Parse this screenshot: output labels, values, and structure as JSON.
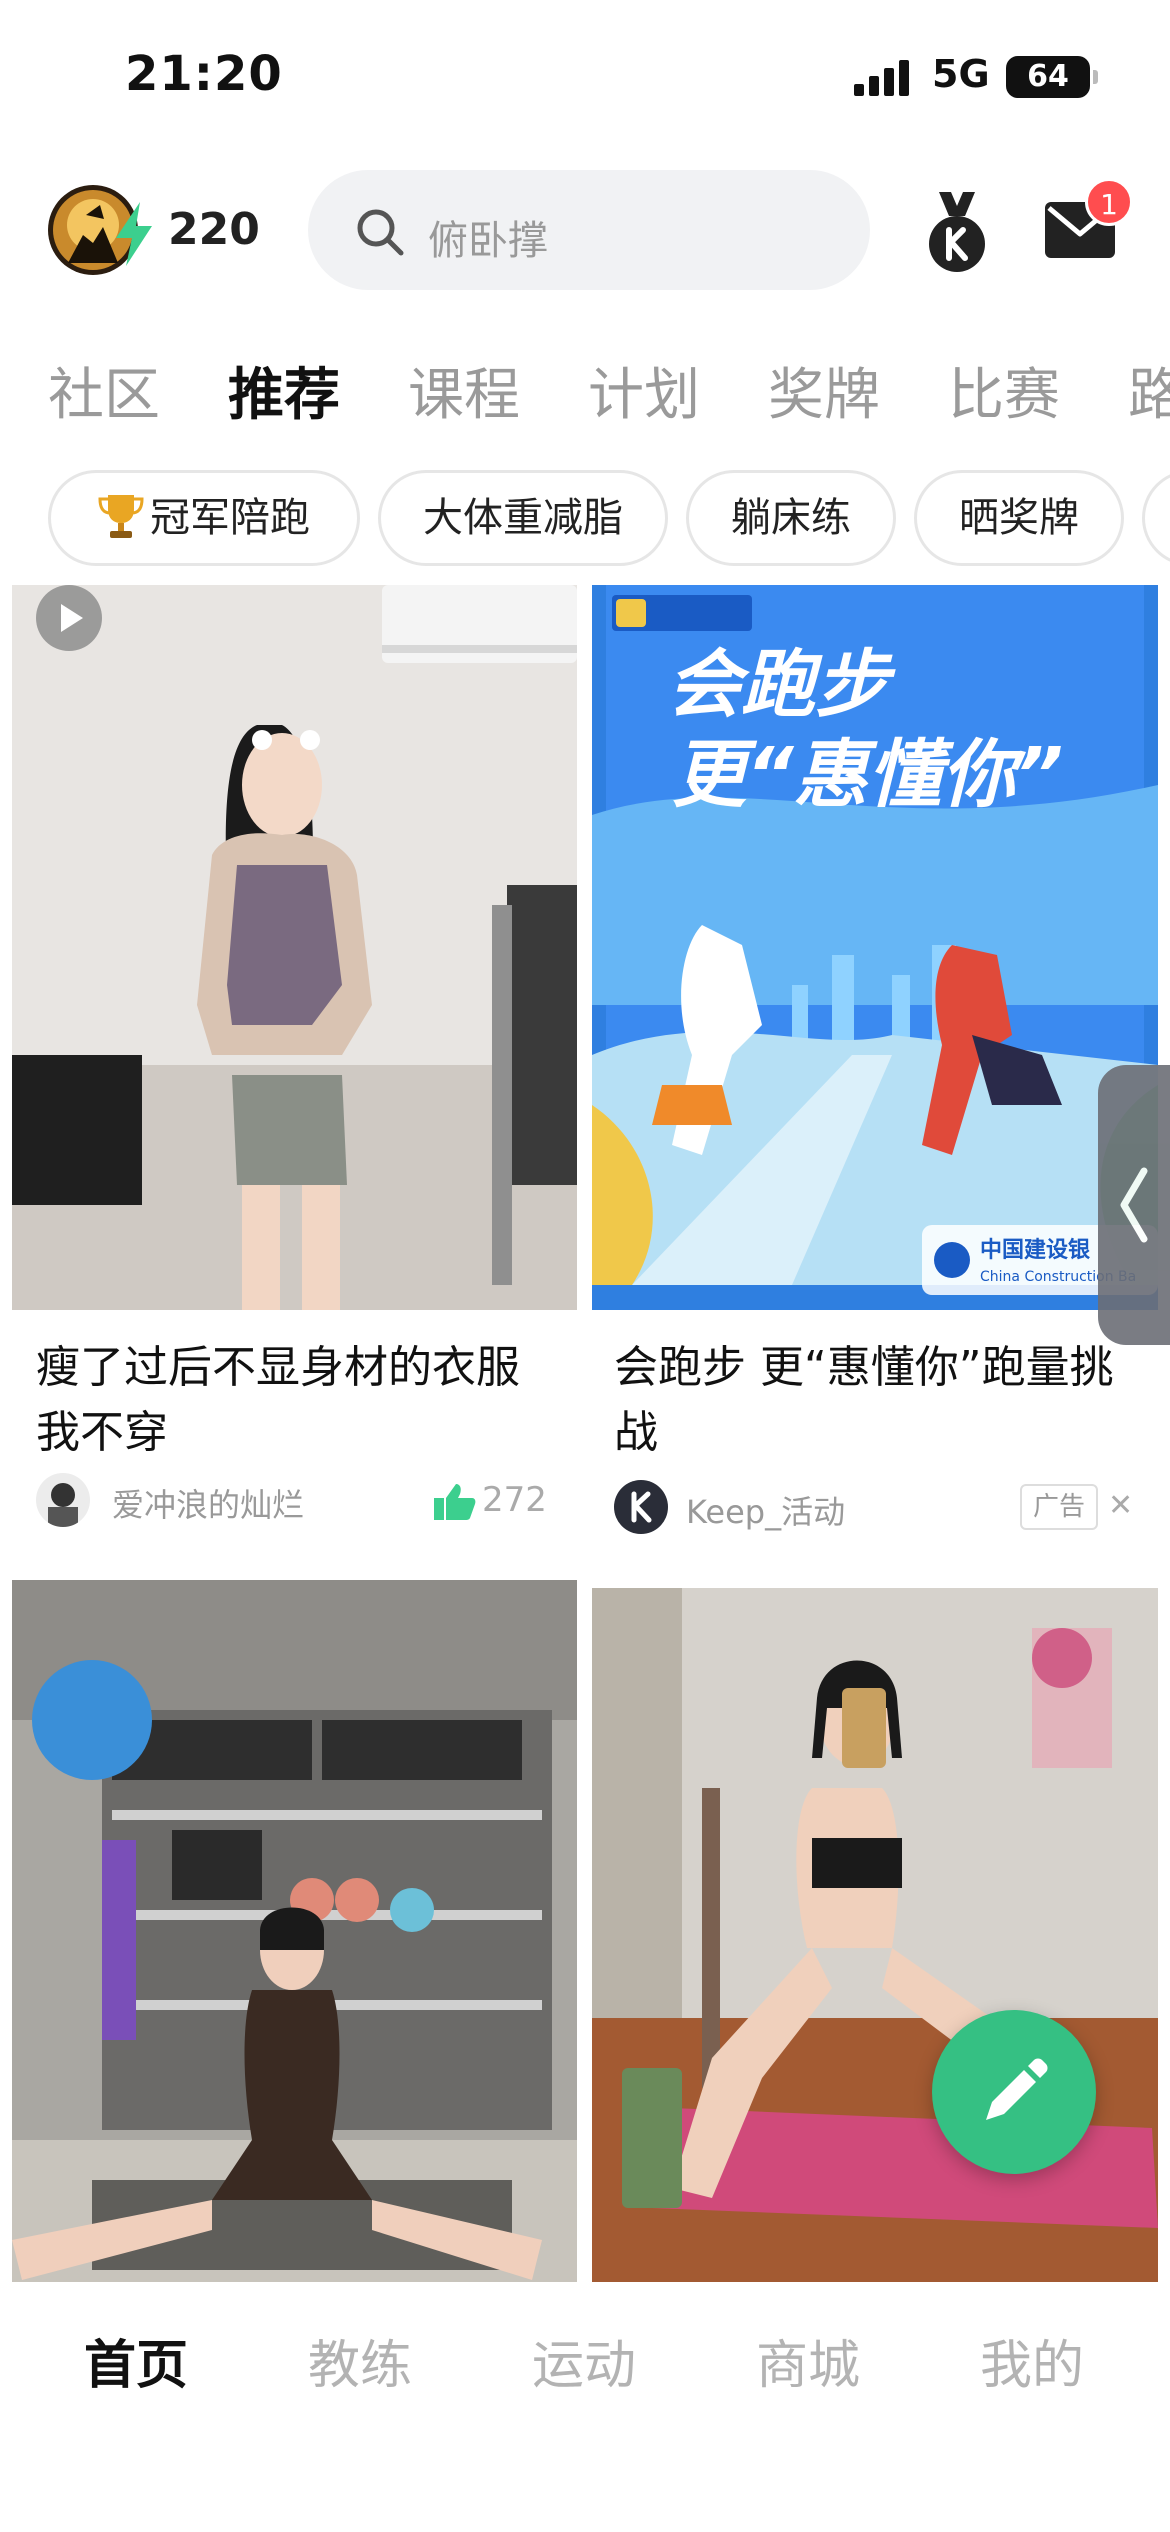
{
  "status_bar": {
    "time": "21:20",
    "network": "5G",
    "battery": "64"
  },
  "header": {
    "points": "220",
    "search_placeholder": "俯卧撑",
    "mail_badge": "1"
  },
  "tabs": [
    {
      "label": "社区",
      "active": false
    },
    {
      "label": "推荐",
      "active": true
    },
    {
      "label": "课程",
      "active": false
    },
    {
      "label": "计划",
      "active": false
    },
    {
      "label": "奖牌",
      "active": false
    },
    {
      "label": "比赛",
      "active": false
    },
    {
      "label": "路",
      "active": false
    }
  ],
  "chips": [
    {
      "label": "冠军陪跑",
      "icon": "trophy-icon"
    },
    {
      "label": "大体重减脂"
    },
    {
      "label": "躺床练"
    },
    {
      "label": "晒奖牌"
    }
  ],
  "feed": {
    "card1": {
      "title_line1": "瘦了过后不显身材的衣服",
      "title_line2": "我不穿",
      "author": "爱冲浪的灿烂",
      "likes": "272"
    },
    "card2": {
      "title_line1": "会跑步 更“惠懂你”跑量挑",
      "title_line2": "战",
      "author": "Keep_活动",
      "ad_label": "广告",
      "poster_line1": "会跑步",
      "poster_line2": "更“惠懂你”",
      "bank_name": "中国建设银",
      "bank_name_en": "China Construction Ba"
    }
  },
  "bottom_nav": [
    {
      "label": "首页",
      "active": true
    },
    {
      "label": "教练",
      "active": false
    },
    {
      "label": "运动",
      "active": false
    },
    {
      "label": "商城",
      "active": false
    },
    {
      "label": "我的",
      "active": false
    }
  ],
  "colors": {
    "accent": "#35c083",
    "tab_highlight": "#7de0b4",
    "badge": "#ff4d4f"
  }
}
